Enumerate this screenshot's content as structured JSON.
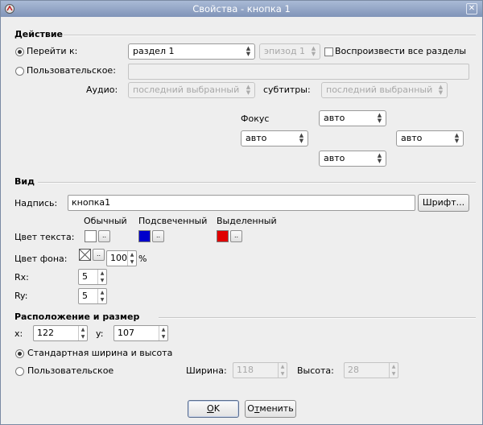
{
  "window": {
    "title": "Свойства - кнопка 1"
  },
  "action": {
    "section": "Действие",
    "goto_label": "Перейти к:",
    "goto_value": "раздел 1",
    "episode_value": "эпизод 1",
    "play_all_label": "Воспроизвести все разделы",
    "custom_label": "Пользовательское:",
    "audio_label": "Аудио:",
    "audio_value": "последний выбранный",
    "subtitles_label": "субтитры:",
    "subtitles_value": "последний выбранный",
    "focus_label": "Фокус",
    "focus_up": "авто",
    "focus_left": "авто",
    "focus_right": "авто",
    "focus_down": "авто"
  },
  "view": {
    "section": "Вид",
    "caption_label": "Надпись:",
    "caption_value": "кнопка1",
    "font_button": "Шрифт...",
    "col_normal": "Обычный",
    "col_highlighted": "Подсвеченный",
    "col_selected": "Выделенный",
    "text_color_label": "Цвет текста:",
    "bg_color_label": "Цвет фона:",
    "bg_opacity": "100",
    "percent": "%",
    "rx_label": "Rx:",
    "rx_value": "5",
    "ry_label": "Ry:",
    "ry_value": "5",
    "ellipsis": "..",
    "colors": {
      "normal": "#ffffff",
      "highlighted": "#0000cc",
      "selected": "#e00000"
    }
  },
  "position": {
    "section": "Расположение и размер",
    "x_label": "x:",
    "x_value": "122",
    "y_label": "y:",
    "y_value": "107",
    "standard_label": "Стандартная ширина и высота",
    "custom_label": "Пользовательское",
    "width_label": "Ширина:",
    "width_value": "118",
    "height_label": "Высота:",
    "height_value": "28"
  },
  "buttons": {
    "ok_u": "O",
    "ok_rest": "K",
    "cancel_pre": "О",
    "cancel_u": "т",
    "cancel_rest": "менить"
  }
}
